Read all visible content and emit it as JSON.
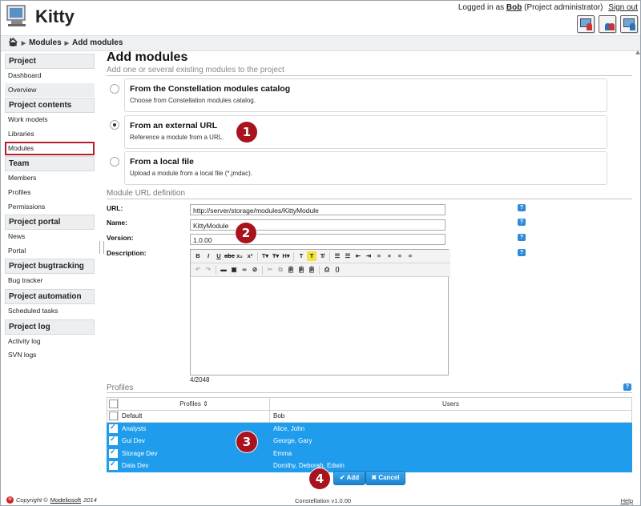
{
  "app": {
    "title": "Kitty"
  },
  "header": {
    "logged_in_as": "Logged in as",
    "user": "Bob",
    "role": "(Project administrator)",
    "sign_out": "Sign out"
  },
  "breadcrumb": {
    "items": [
      "Modules",
      "Add modules"
    ]
  },
  "sidebar": {
    "sections": [
      {
        "title": "Project",
        "items": [
          "Dashboard",
          "Overview"
        ]
      },
      {
        "title": "Project contents",
        "items": [
          "Work models",
          "Libraries",
          "Modules"
        ]
      },
      {
        "title": "Team",
        "items": [
          "Members",
          "Profiles",
          "Permissions"
        ]
      },
      {
        "title": "Project portal",
        "items": [
          "News",
          "Portal"
        ]
      },
      {
        "title": "Project bugtracking",
        "items": [
          "Bug tracker"
        ]
      },
      {
        "title": "Project automation",
        "items": [
          "Scheduled tasks"
        ]
      },
      {
        "title": "Project log",
        "items": [
          "Activity log",
          "SVN logs"
        ]
      }
    ],
    "active_item": "Modules"
  },
  "main": {
    "title": "Add modules",
    "subtitle": "Add one or several existing modules to the project",
    "options": [
      {
        "title": "From the Constellation modules catalog",
        "desc": "Choose from Constellation modules catalog.",
        "selected": false
      },
      {
        "title": "From an external URL",
        "desc": "Reference a module from a URL.",
        "selected": true
      },
      {
        "title": "From a local file",
        "desc": "Upload a module from a local file (*.jmdac).",
        "selected": false
      }
    ],
    "url_section": "Module URL definition",
    "fields": {
      "url_label": "URL:",
      "url_value": "http://server/storage/modules/KittyModule",
      "name_label": "Name:",
      "name_value": "KittyModule",
      "version_label": "Version:",
      "version_value": "1.0.00",
      "description_label": "Description:"
    },
    "char_counter": "4/2048",
    "help_glyph": "?",
    "profiles": {
      "legend": "Profiles",
      "col_profiles": "Profiles ⇕",
      "col_users": "Users",
      "rows": [
        {
          "profile": "Default",
          "users": "Bob",
          "checked": false,
          "selected": false
        },
        {
          "profile": "Analysts",
          "users": "Alice, John",
          "checked": true,
          "selected": true
        },
        {
          "profile": "Gui Dev",
          "users": "George, Gary",
          "checked": true,
          "selected": true
        },
        {
          "profile": "Storage Dev",
          "users": "Emma",
          "checked": true,
          "selected": true
        },
        {
          "profile": "Data Dev",
          "users": "Dorothy, Deborah, Edwin",
          "checked": true,
          "selected": true
        }
      ]
    },
    "buttons": {
      "add": "✔ Add",
      "cancel": "✖ Cancel"
    }
  },
  "callouts": [
    "1",
    "2",
    "3",
    "4"
  ],
  "footer": {
    "copyright": "Copyright ©",
    "company": "Modeliosoft",
    "year": "2014",
    "version": "Constellation v1.0.00",
    "help": "Help"
  }
}
